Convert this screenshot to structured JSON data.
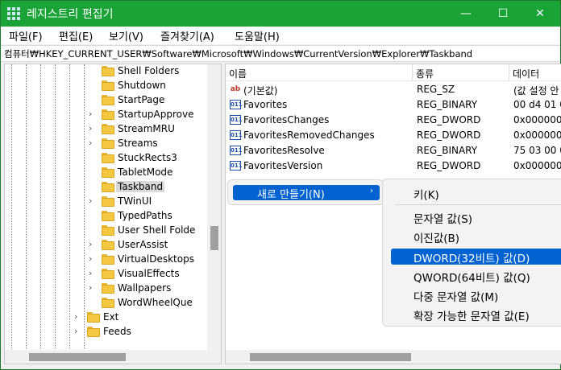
{
  "window": {
    "title": "레지스트리 편집기",
    "controls": {
      "minimize": "—",
      "maximize": "☐",
      "close": "✕"
    }
  },
  "menu": [
    "파일(F)",
    "편집(E)",
    "보기(V)",
    "즐겨찾기(A)",
    "도움말(H)"
  ],
  "address": "컴퓨터₩HKEY_CURRENT_USER₩Software₩Microsoft₩Windows₩CurrentVersion₩Explorer₩Taskband",
  "tree": {
    "items": [
      {
        "label": "Shell Folders",
        "chevron": ""
      },
      {
        "label": "Shutdown",
        "chevron": ""
      },
      {
        "label": "StartPage",
        "chevron": ""
      },
      {
        "label": "StartupApprove",
        "chevron": "›"
      },
      {
        "label": "StreamMRU",
        "chevron": "›"
      },
      {
        "label": "Streams",
        "chevron": "›"
      },
      {
        "label": "StuckRects3",
        "chevron": ""
      },
      {
        "label": "TabletMode",
        "chevron": ""
      },
      {
        "label": "Taskband",
        "chevron": "",
        "selected": true
      },
      {
        "label": "TWinUI",
        "chevron": "›"
      },
      {
        "label": "TypedPaths",
        "chevron": ""
      },
      {
        "label": "User Shell Folde",
        "chevron": ""
      },
      {
        "label": "UserAssist",
        "chevron": "›"
      },
      {
        "label": "VirtualDesktops",
        "chevron": "›"
      },
      {
        "label": "VisualEffects",
        "chevron": "›"
      },
      {
        "label": "Wallpapers",
        "chevron": "›"
      },
      {
        "label": "WordWheelQue",
        "chevron": ""
      },
      {
        "label": "Ext",
        "chevron": "›"
      },
      {
        "label": "Feeds",
        "chevron": "›"
      }
    ]
  },
  "list": {
    "columns": [
      "이름",
      "종류",
      "데이터"
    ],
    "rows": [
      {
        "icon": "ab",
        "name": "(기본값)",
        "type": "REG_SZ",
        "data": "(값 설정 안"
      },
      {
        "icon": "bin",
        "name": "Favorites",
        "type": "REG_BINARY",
        "data": "00 d4 01 0"
      },
      {
        "icon": "bin",
        "name": "FavoritesChanges",
        "type": "REG_DWORD",
        "data": "0x0000000"
      },
      {
        "icon": "bin",
        "name": "FavoritesRemovedChanges",
        "type": "REG_DWORD",
        "data": "0x0000000"
      },
      {
        "icon": "bin",
        "name": "FavoritesResolve",
        "type": "REG_BINARY",
        "data": "75 03 00 0"
      },
      {
        "icon": "bin",
        "name": "FavoritesVersion",
        "type": "REG_DWORD",
        "data": "0x0000000"
      }
    ]
  },
  "context_menu": {
    "new_label": "새로 만들기(N)",
    "arrow": "›"
  },
  "submenu": {
    "items": [
      {
        "label": "키(K)"
      },
      {
        "label": "문자열 값(S)"
      },
      {
        "label": "이진값(B)"
      },
      {
        "label": "DWORD(32비트) 값(D)",
        "active": true
      },
      {
        "label": "QWORD(64비트) 값(Q)"
      },
      {
        "label": "다중 문자열 값(M)"
      },
      {
        "label": "확장 가능한 문자열 값(E)"
      }
    ]
  },
  "colors": {
    "titlebar": "#1aa336",
    "highlight": "#0063d1",
    "folder": "#f5c842"
  }
}
